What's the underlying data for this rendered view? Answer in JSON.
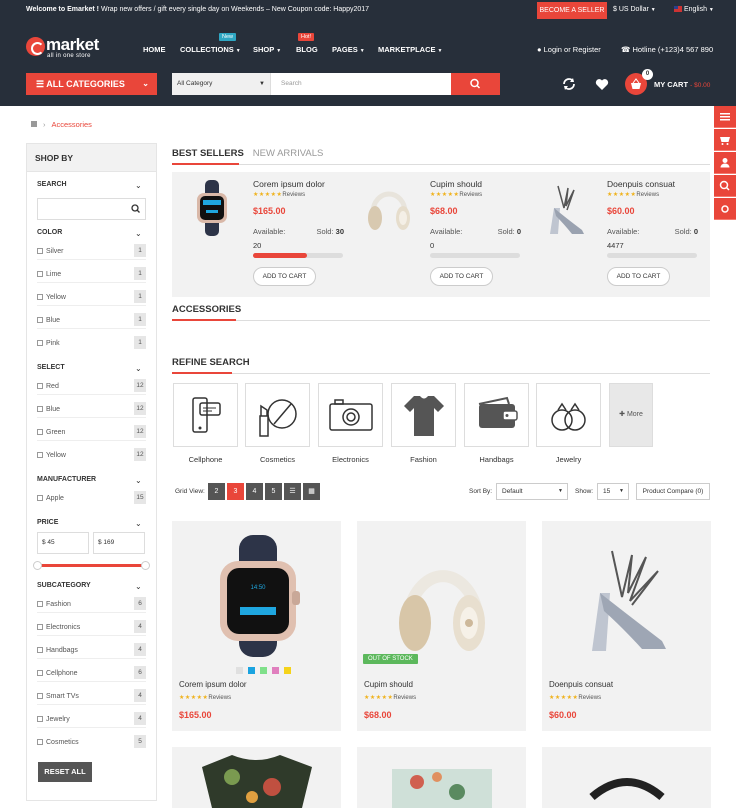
{
  "topbar": {
    "welcome_bold": "Welcome to Emarket !",
    "welcome_text": "Wrap new offers / gift every single day on Weekends – New Coupon code: Happy2017",
    "seller_button": "BECOME A SELLER",
    "currency": "$ US Dollar",
    "language": "English"
  },
  "header": {
    "logo_name": "market",
    "logo_tagline": "all in one store",
    "nav": [
      {
        "label": "HOME"
      },
      {
        "label": "COLLECTIONS",
        "badge": "New"
      },
      {
        "label": "SHOP"
      },
      {
        "label": "BLOG",
        "badge": "Hot!"
      },
      {
        "label": "PAGES"
      },
      {
        "label": "MARKETPLACE"
      }
    ],
    "login": "Login or Register",
    "hotline": "Hotline (+123)4 567 890",
    "all_categories": "ALL CATEGORIES",
    "search_category": "All Category",
    "search_placeholder": "Search",
    "cart_count": "0",
    "cart_label": "MY CART",
    "cart_price": "- $0.00"
  },
  "breadcrumb": {
    "current": "Accessories"
  },
  "sidebar": {
    "title": "SHOP BY",
    "search_title": "SEARCH",
    "color_title": "COLOR",
    "colors": [
      {
        "label": "Silver",
        "count": "1"
      },
      {
        "label": "Lime",
        "count": "1"
      },
      {
        "label": "Yellow",
        "count": "1"
      },
      {
        "label": "Blue",
        "count": "1"
      },
      {
        "label": "Pink",
        "count": "1"
      }
    ],
    "select_title": "SELECT",
    "selects": [
      {
        "label": "Red",
        "count": "12"
      },
      {
        "label": "Blue",
        "count": "12"
      },
      {
        "label": "Green",
        "count": "12"
      },
      {
        "label": "Yellow",
        "count": "12"
      }
    ],
    "manufacturer_title": "MANUFACTURER",
    "manufacturers": [
      {
        "label": "Apple",
        "count": "15"
      }
    ],
    "price_title": "PRICE",
    "price_min": "$ 45",
    "price_max": "$ 169",
    "subcategory_title": "SUBCATEGORY",
    "subcategories": [
      {
        "label": "Fashion",
        "count": "6"
      },
      {
        "label": "Electronics",
        "count": "4"
      },
      {
        "label": "Handbags",
        "count": "4"
      },
      {
        "label": "Cellphone",
        "count": "6"
      },
      {
        "label": "Smart TVs",
        "count": "4"
      },
      {
        "label": "Jewelry",
        "count": "4"
      },
      {
        "label": "Cosmetics",
        "count": "5"
      }
    ],
    "reset": "RESET ALL"
  },
  "tabs": {
    "best_sellers": "BEST SELLERS",
    "new_arrivals": "NEW ARRIVALS"
  },
  "best_sellers": [
    {
      "name": "Corem ipsum dolor",
      "reviews": "Reviews",
      "price": "$165.00",
      "available_label": "Available:",
      "sold_label": "Sold:",
      "sold": "30",
      "available": "20",
      "sold_fraction": 0.6,
      "button": "ADD TO CART"
    },
    {
      "name": "Cupim should",
      "reviews": "Reviews",
      "price": "$68.00",
      "available_label": "Available:",
      "sold_label": "Sold:",
      "sold": "0",
      "available": "0",
      "sold_fraction": 0,
      "button": "ADD TO CART"
    },
    {
      "name": "Doenpuis consuat",
      "reviews": "Reviews",
      "price": "$60.00",
      "available_label": "Available:",
      "sold_label": "Sold:",
      "sold": "0",
      "available": "4477",
      "sold_fraction": 0,
      "button": "ADD TO CART"
    }
  ],
  "accessories_title": "ACCESSORIES",
  "refine_title": "REFINE SEARCH",
  "categories": [
    {
      "label": "Cellphone",
      "icon": "cellphone-icon"
    },
    {
      "label": "Cosmetics",
      "icon": "cosmetics-icon"
    },
    {
      "label": "Electronics",
      "icon": "camera-icon"
    },
    {
      "label": "Fashion",
      "icon": "tshirt-icon"
    },
    {
      "label": "Handbags",
      "icon": "wallet-icon"
    },
    {
      "label": "Jewelry",
      "icon": "rings-icon"
    }
  ],
  "more_label": "More",
  "toolbar": {
    "grid_view": "Grid View:",
    "grid_options": [
      "2",
      "3",
      "4",
      "5"
    ],
    "active_grid": "3",
    "sort_label": "Sort By:",
    "sort_value": "Default",
    "show_label": "Show:",
    "show_value": "15",
    "compare": "Product Compare (0)"
  },
  "products": [
    {
      "name": "Corem ipsum dolor",
      "reviews": "Reviews",
      "price": "$165.00",
      "swatches": [
        "#e0e0e0",
        "#1aa3e0",
        "#7fe08a",
        "#e07fbe",
        "#f5d31a"
      ]
    },
    {
      "name": "Cupim should",
      "reviews": "Reviews",
      "price": "$68.00",
      "badge": "OUT OF STOCK"
    },
    {
      "name": "Doenpuis consuat",
      "reviews": "Reviews",
      "price": "$60.00"
    }
  ],
  "colors": {
    "accent": "#e9463a",
    "dark": "#272f3a",
    "stars": "#f0b21c"
  }
}
